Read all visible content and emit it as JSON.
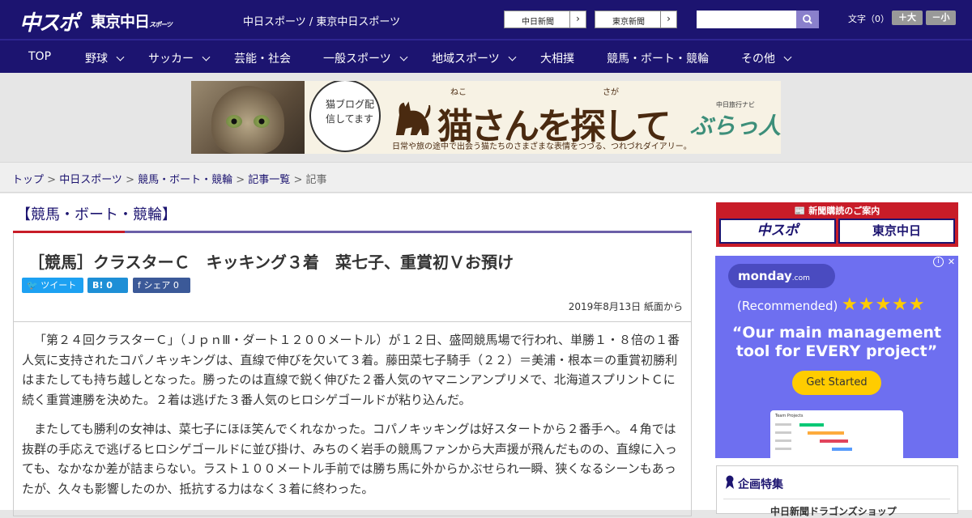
{
  "header": {
    "logo_main": "中スポ",
    "logo_tokyo": "東京中日",
    "logo_tokyo_small": "スポーツ",
    "site_links": "中日スポーツ / 東京中日スポーツ",
    "paper_buttons": [
      "中日新聞",
      "東京新聞"
    ],
    "search_placeholder": "",
    "fontsize_label": "文字（0）",
    "fontsize_up": "＋大",
    "fontsize_down": "－小"
  },
  "nav": {
    "items": [
      "TOP",
      "野球",
      "サッカー",
      "芸能・社会",
      "一般スポーツ",
      "地域スポーツ",
      "大相撲",
      "競馬・ボート・競輪",
      "その他"
    ]
  },
  "ad_banner": {
    "bubble": "猫ブログ配信してます",
    "headline": "猫さんを探して",
    "ruby1": "ねこ",
    "ruby2": "さが",
    "sub": "日常や旅の途中で出会う猫たちのさまざまな表情をつづる、つれづれダイアリー。",
    "brand_small": "中日旅行ナビ",
    "brand": "ぶらっ人"
  },
  "breadcrumb": [
    "トップ",
    "中日スポーツ",
    "競馬・ボート・競輪",
    "記事一覧",
    "記事"
  ],
  "article": {
    "category": "【競馬・ボート・競輪】",
    "title": "［競馬］クラスターＣ　キッキング３着　菜七子、重賞初Ｖお預け",
    "share": {
      "tweet": "ツイート",
      "hatena": "0",
      "facebook": "シェア 0"
    },
    "date": "2019年8月13日 紙面から",
    "paragraphs": [
      "「第２４回クラスターＣ」（ＪｐｎⅢ・ダート１２００メートル）が１２日、盛岡競馬場で行われ、単勝１・８倍の１番人気に支持されたコパノキッキングは、直線で伸びを欠いて３着。藤田菜七子騎手（２２）＝美浦・根本＝の重賞初勝利はまたしても持ち越しとなった。勝ったのは直線で鋭く伸びた２番人気のヤマニンアンプリメで、北海道スプリントＣに続く重賞連勝を決めた。２着は逃げた３番人気のヒロシゲゴールドが粘り込んだ。",
      "またしても勝利の女神は、菜七子にほほ笑んでくれなかった。コパノキッキングは好スタートから２番手へ。４角では抜群の手応えで逃げるヒロシゲゴールドに並び掛け、みちのく岩手の競馬ファンから大声援が飛んだものの、直線に入っても、なかなか差が詰まらない。ラスト１００メートル手前では勝ち馬に外からかぶせられ一瞬、狭くなるシーンもあったが、久々も影響したのか、抵抗する力はなく３着に終わった。"
    ]
  },
  "sidebar": {
    "subscribe_title": "新聞購読のご案内",
    "subscribe_logos": [
      "中スポ",
      "東京中日"
    ],
    "monday": {
      "logo": "monday",
      "logo_suffix": ".com",
      "recommended": "(Recommended)",
      "stars": "★★★★★",
      "tagline": "“Our main management tool for EVERY project”",
      "cta": "Get Started",
      "info": "i",
      "close": "✕",
      "shot_title": "Team Projects"
    },
    "features_title": "企画特集",
    "features_item": "中日新聞ドラゴンズショップ"
  }
}
